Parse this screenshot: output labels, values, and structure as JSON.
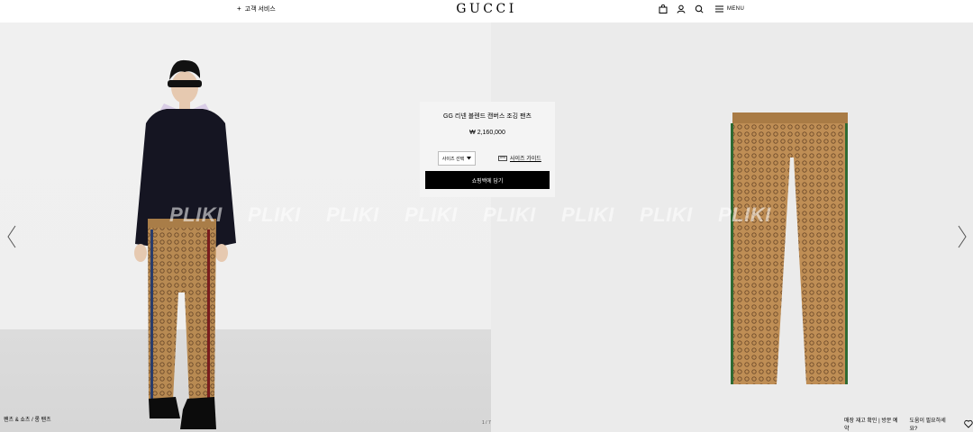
{
  "header": {
    "customer_service": "고객 서비스",
    "logo": "GUCCI",
    "menu_label": "MENU",
    "icons": [
      "shopping-bag-icon",
      "user-icon",
      "search-icon",
      "menu-icon"
    ]
  },
  "product": {
    "name": "GG 리넨 블렌드 캔버스 조깅 팬츠",
    "price": "₩ 2,160,000",
    "size_select": "사이즈 선택",
    "size_guide": "사이즈 가이드",
    "add_to_bag": "쇼핑백에 담기"
  },
  "watermark": [
    "PLIKI",
    "PLIKI",
    "PLIKI",
    "PLIKI",
    "PLIKI",
    "PLIKI",
    "PLIKI",
    "PLIKI"
  ],
  "breadcrumb": {
    "item1": "팬츠 & 쇼츠",
    "separator": "/",
    "item2": "롱 팬츠"
  },
  "pager": "1 / 7",
  "bottom": {
    "store": "매장 재고 확인 | 방문 예약",
    "help": "도움이 필요하세요?"
  },
  "colors": {
    "header_bg": "#ffffff",
    "left_bg": "#efefef",
    "right_bg": "#ebebeb",
    "button": "#000000"
  }
}
